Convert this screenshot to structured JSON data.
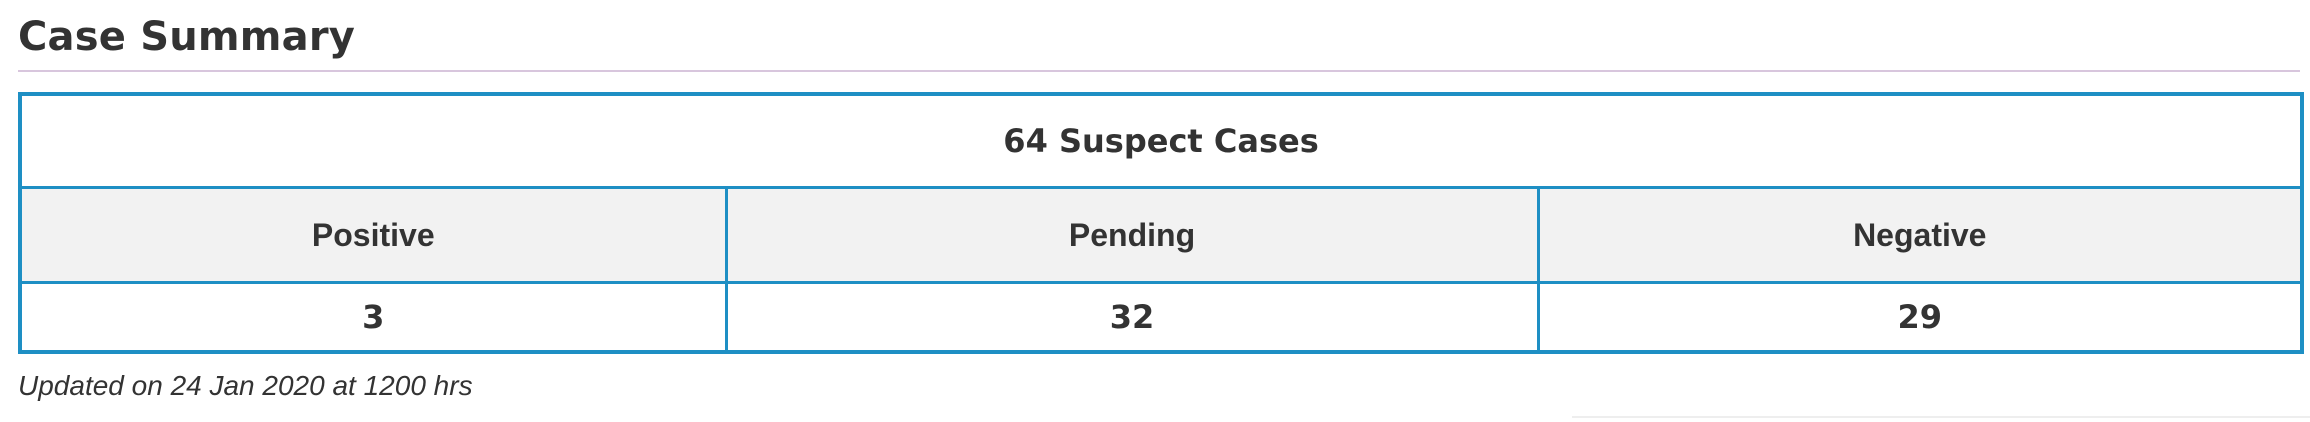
{
  "section": {
    "title": "Case Summary"
  },
  "summary_table": {
    "total_label": "64 Suspect Cases",
    "columns": [
      "Positive",
      "Pending",
      "Negative"
    ],
    "values": [
      "3",
      "32",
      "29"
    ]
  },
  "footer": {
    "updated_text": "Updated on 24 Jan 2020 at 1200 hrs"
  },
  "colors": {
    "table_border": "#1e8fc4",
    "header_background": "#f2f2f2",
    "title_rule": "#d8c6dd",
    "text": "#333333"
  }
}
